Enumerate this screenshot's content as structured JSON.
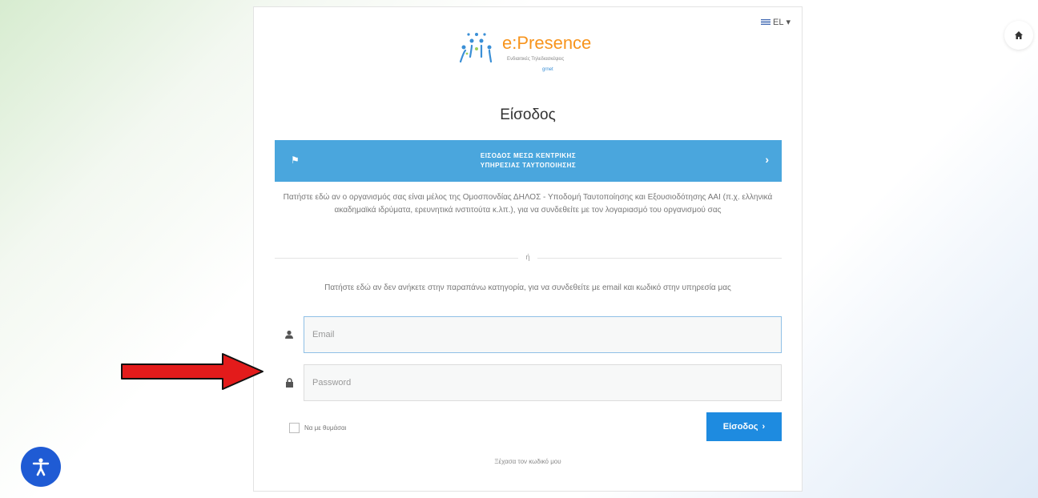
{
  "header": {
    "language": "EL"
  },
  "logo": {
    "name": "e:Presence",
    "subtitle": "Ενδιαιτικές Τηλεδιασκέψεις",
    "org": "grnet"
  },
  "page_title": "Είσοδος",
  "sso_button": {
    "line1": "ΕΙΣΟΔΟΣ ΜΕΣΩ ΚΕΝΤΡΙΚΗΣ",
    "line2": "ΥΠΗΡΕΣΙΑΣ ΤΑΥΤΟΠΟΙΗΣΗΣ"
  },
  "sso_description": "Πατήστε εδώ αν ο οργανισμός σας είναι μέλος της Ομοσπονδίας ΔΗΛΟΣ - Υποδομή Ταυτοποίησης και Εξουσιοδότησης ΑΑΙ (π.χ. ελληνικά ακαδημαϊκά ιδρύματα, ερευνητικά ινστιτούτα κ.λπ.), για να συνδεθείτε με τον λογαριασμό του οργανισμού σας",
  "or_text": "ή",
  "local_description": "Πατήστε εδώ αν δεν ανήκετε στην παραπάνω κατηγορία, για να συνδεθείτε με email και κωδικό στην υπηρεσία μας",
  "form": {
    "email_placeholder": "Email",
    "password_placeholder": "Password",
    "remember_label": "Να με θυμάσαι",
    "submit_label": "Είσοδος",
    "forgot_label": "Ξέχασα τον κωδικό μου"
  },
  "icons": {
    "flag": "flag-icon",
    "chevron": "chevron-right-icon",
    "user": "user-icon",
    "lock": "lock-icon",
    "home": "home-icon",
    "accessibility": "accessibility-icon",
    "arrow": "red-arrow-annotation"
  },
  "colors": {
    "sso": "#4aa6dd",
    "primary": "#1e8be0",
    "accessibility": "#1f5bd4",
    "arrow": "#e31b1b"
  }
}
